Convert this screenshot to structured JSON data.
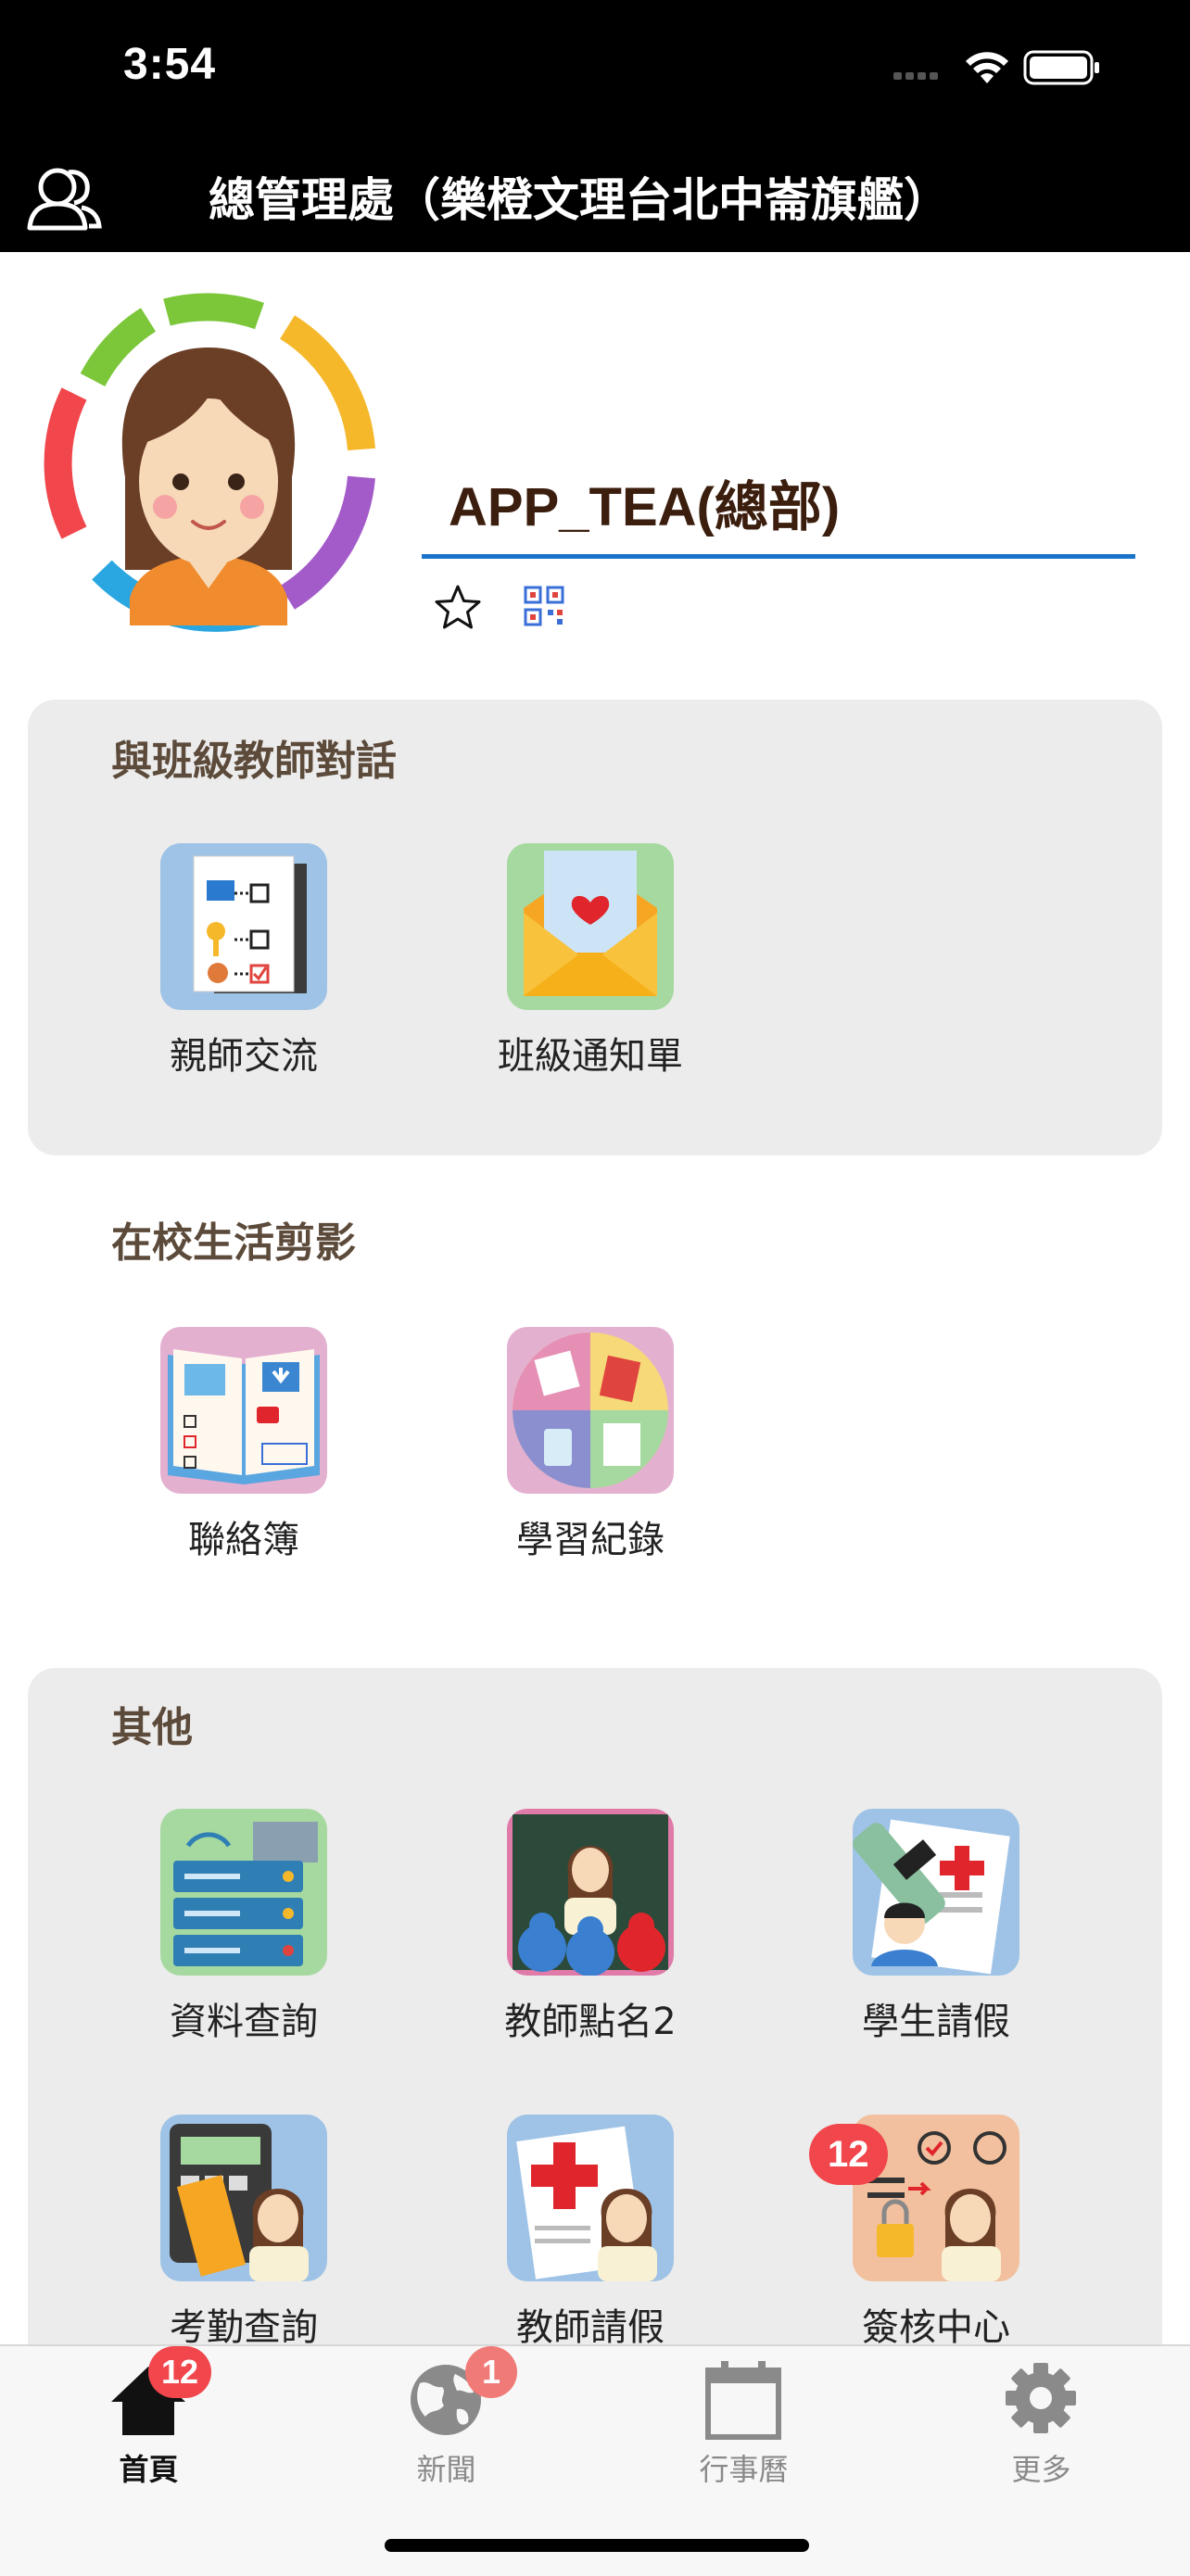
{
  "status": {
    "time": "3:54"
  },
  "header": {
    "title": "總管理處（樂橙文理台北中崙旗艦）"
  },
  "profile": {
    "name": "APP_TEA(總部)"
  },
  "sections": [
    {
      "title": "與班級教師對話",
      "items": [
        {
          "label": "親師交流"
        },
        {
          "label": "班級通知單"
        }
      ]
    },
    {
      "title": "在校生活剪影",
      "items": [
        {
          "label": "聯絡簿"
        },
        {
          "label": "學習紀錄"
        }
      ]
    },
    {
      "title": "其他",
      "items": [
        {
          "label": "資料查詢"
        },
        {
          "label": "教師點名2"
        },
        {
          "label": "學生請假"
        },
        {
          "label": "考勤查詢"
        },
        {
          "label": "教師請假"
        },
        {
          "label": "簽核中心",
          "badge": "12"
        }
      ]
    }
  ],
  "tabbar": {
    "tabs": [
      {
        "label": "首頁",
        "badge": "12",
        "icon": "home-icon"
      },
      {
        "label": "新聞",
        "badge": "1",
        "icon": "globe-icon"
      },
      {
        "label": "行事曆",
        "icon": "calendar-icon"
      },
      {
        "label": "更多",
        "icon": "gear-icon"
      }
    ]
  },
  "colors": {
    "badge": "#f0464c",
    "accent_line": "#1a73c9",
    "card_bg": "#ececec"
  }
}
